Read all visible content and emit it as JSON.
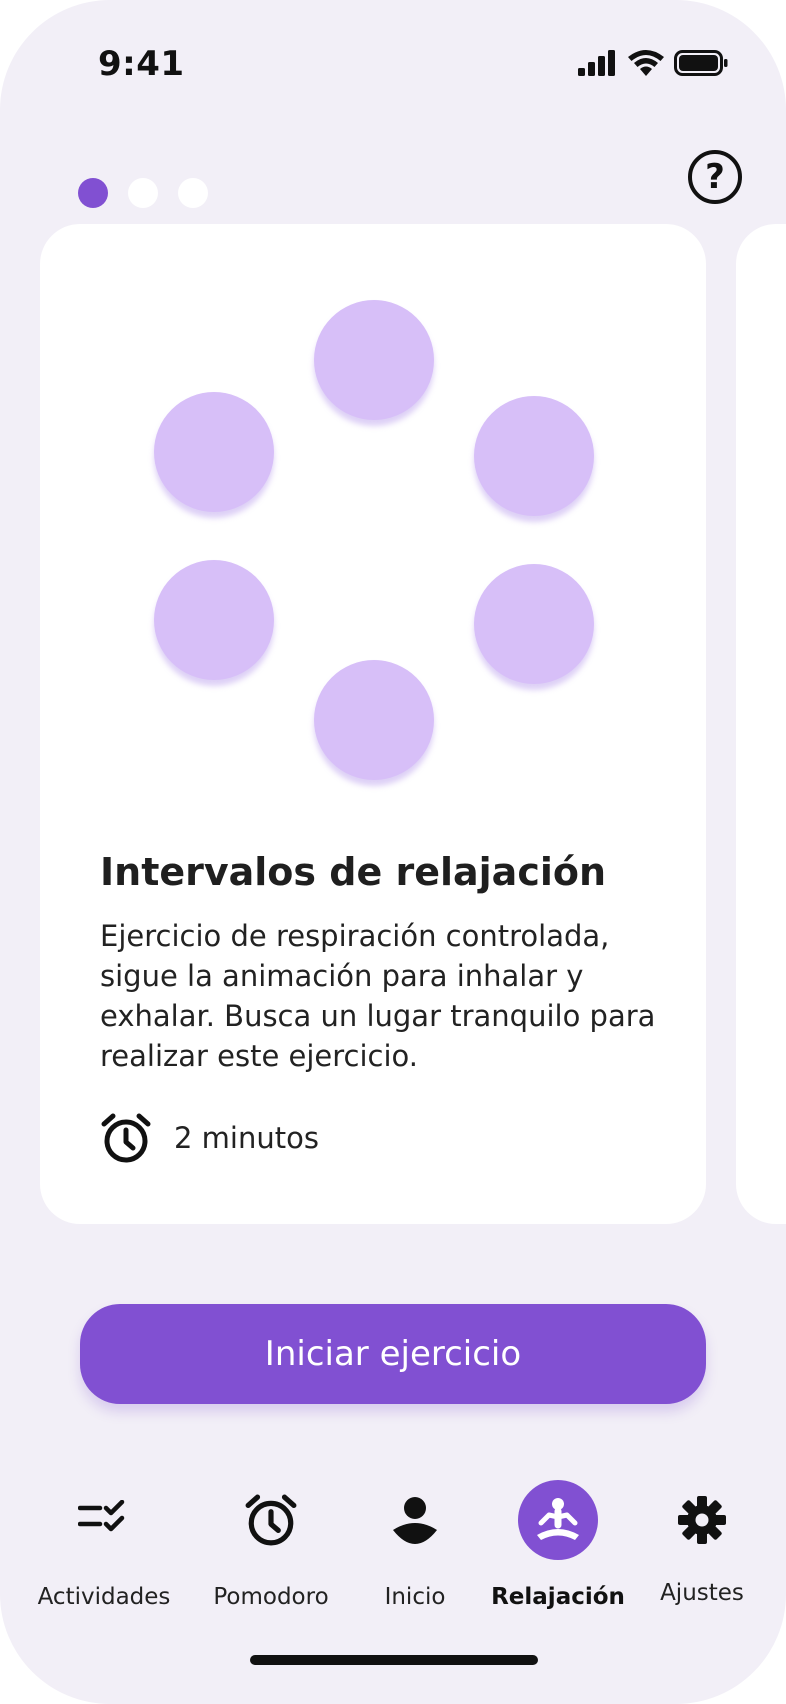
{
  "status_bar": {
    "time": "9:41"
  },
  "pager": {
    "pages": 3,
    "active_index": 0
  },
  "card": {
    "title": "Intervalos de relajación",
    "description": "Ejercicio de respiración controlada, sigue la animación para inhalar y exhalar. Busca un lugar tranquilo para realizar este ejercicio.",
    "duration": "2 minutos"
  },
  "cta": {
    "label": "Iniciar ejercicio"
  },
  "tabs": [
    {
      "label": "Actividades",
      "icon": "checklist-icon"
    },
    {
      "label": "Pomodoro",
      "icon": "alarm-clock-icon"
    },
    {
      "label": "Inicio",
      "icon": "person-icon"
    },
    {
      "label": "Relajación",
      "icon": "meditation-icon",
      "active": true
    },
    {
      "label": "Ajustes",
      "icon": "gear-icon"
    }
  ],
  "colors": {
    "accent": "#8150d2",
    "circle": "#d7bff8",
    "background": "#f2eff7",
    "card": "#ffffff"
  }
}
